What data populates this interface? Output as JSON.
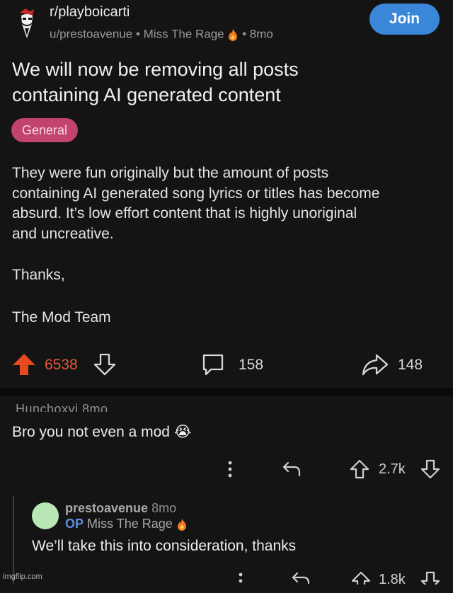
{
  "subreddit": {
    "name": "r/playboicarti",
    "poster": "u/prestoavenue",
    "poster_flair": "Miss The Rage",
    "age": "8mo",
    "join_label": "Join"
  },
  "post": {
    "title_line1": "We will now be removing all posts",
    "title_line2": "containing AI generated content",
    "flair": "General",
    "body_lines": [
      "They were fun originally but the amount of posts",
      "containing AI generated song lyrics or titles has become",
      "absurd. It’s low effort content that is highly unoriginal",
      "and uncreative."
    ],
    "thanks": "Thanks,",
    "signature": "The Mod Team",
    "votes": "6538",
    "comments": "158",
    "shares": "148"
  },
  "comment1": {
    "author_cut": "Hunchoxvi 8mo",
    "text": "Bro you not even a mod",
    "emoji": "😭",
    "votes": "2.7k"
  },
  "reply": {
    "author": "prestoavenue",
    "age": "8mo",
    "op_tag": "OP",
    "flair": "Miss The Rage",
    "text": "We’ll take this into consideration, thanks",
    "votes": "1.8k"
  },
  "watermark": "imgflip.com",
  "colors": {
    "background": "#141414",
    "join": "#3a86d9",
    "flair": "#c2436e",
    "upvote": "#e05a3a",
    "op": "#5b8fe0"
  }
}
